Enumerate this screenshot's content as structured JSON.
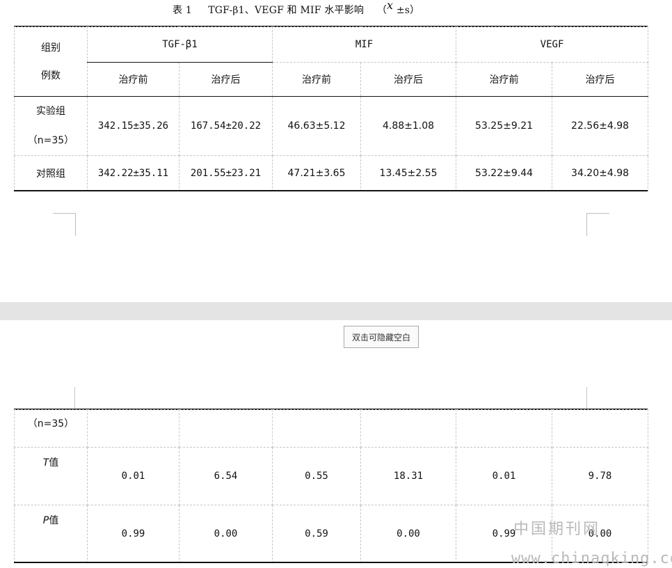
{
  "caption": {
    "label": "表 1",
    "title": "TGF-β1、VEGF 和 MIF 水平影响",
    "open_paren": "（",
    "mean_symbol": "x",
    "suffix": "±s）"
  },
  "top_table": {
    "group_header_line1": "组别",
    "group_header_line2": "例数",
    "col_groups": [
      "TGF-β1",
      "MIF",
      "VEGF"
    ],
    "sub_headers": [
      "治疗前",
      "治疗后",
      "治疗前",
      "治疗后",
      "治疗前",
      "治疗后"
    ],
    "rows": [
      {
        "label_line1": "实验组",
        "label_line2": "（n=35）",
        "values": [
          "342.15±35.26",
          "167.54±20.22",
          "46.63±5.12",
          "4.88±1.08",
          "53.25±9.21",
          "22.56±4.98"
        ]
      },
      {
        "label_line1": "对照组",
        "values": [
          "342.22±35.11",
          "201.55±23.21",
          "47.21±3.65",
          "13.45±2.55",
          "53.22±9.44",
          "34.20±4.98"
        ]
      }
    ]
  },
  "hide_blank_button": "双击可隐藏空白",
  "bottom_table": {
    "rows": [
      {
        "label": "（n=35）",
        "values": [
          "",
          "",
          "",
          "",
          "",
          ""
        ]
      },
      {
        "label_letter": "T",
        "label_suffix": "值",
        "values": [
          "0.01",
          "6.54",
          "0.55",
          "18.31",
          "0.01",
          "9.78"
        ]
      },
      {
        "label_letter": "P",
        "label_suffix": "值",
        "values": [
          "0.99",
          "0.00",
          "0.59",
          "0.00",
          "0.99",
          "0.00"
        ]
      }
    ]
  },
  "watermark": {
    "line1": "中国期刊网",
    "line2": "www.chinaqking.com"
  }
}
